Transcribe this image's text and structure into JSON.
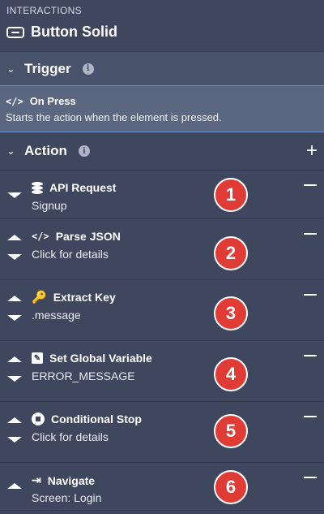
{
  "panel": {
    "kicker": "INTERACTIONS",
    "component_title": "Button Solid",
    "component_icon": "button-solid-icon"
  },
  "trigger": {
    "section_title": "Trigger",
    "name": "On Press",
    "description": "Starts the action when the element is pressed.",
    "icon": "code-icon"
  },
  "actions": {
    "section_title": "Action",
    "items": [
      {
        "number": "1",
        "title": "API Request",
        "subtitle": "Signup",
        "icon": "database-icon"
      },
      {
        "number": "2",
        "title": "Parse JSON",
        "subtitle": "Click for details",
        "icon": "code-icon"
      },
      {
        "number": "3",
        "title": "Extract Key",
        "subtitle": ".message",
        "icon": "key-icon"
      },
      {
        "number": "4",
        "title": "Set Global Variable",
        "subtitle": "ERROR_MESSAGE",
        "icon": "pencil-icon"
      },
      {
        "number": "5",
        "title": "Conditional Stop",
        "subtitle": "Click for details",
        "icon": "stop-icon"
      },
      {
        "number": "6",
        "title": "Navigate",
        "subtitle": "Screen: Login",
        "icon": "navigate-icon"
      }
    ]
  },
  "colors": {
    "panel_bg": "#3e475e",
    "section_bg": "#48526a",
    "trigger_selected_bg": "#5b6780",
    "badge_red": "#e13b36"
  }
}
